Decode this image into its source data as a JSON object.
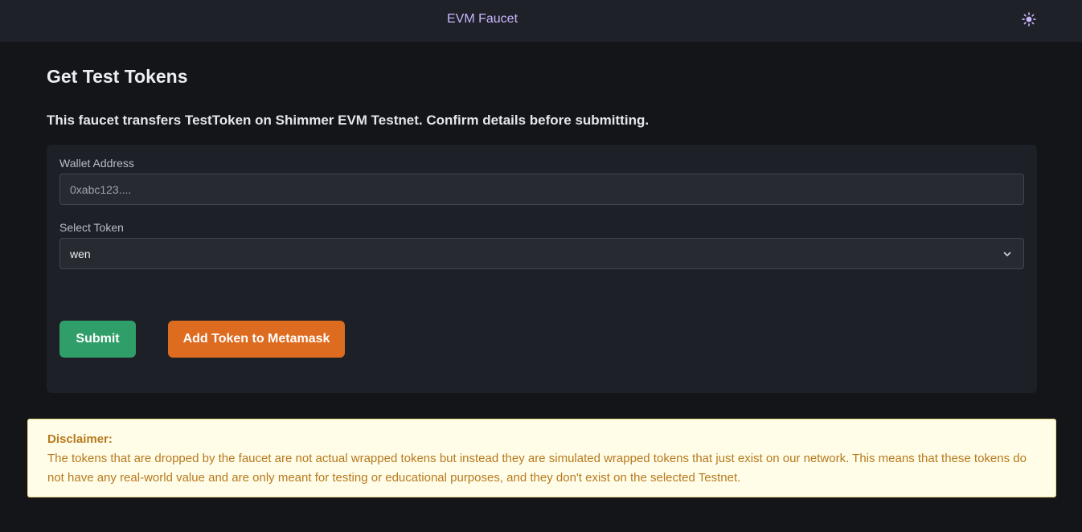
{
  "header": {
    "title": "EVM Faucet",
    "theme_icon": "sun-icon"
  },
  "main": {
    "heading": "Get Test Tokens",
    "subheading": "This faucet transfers TestToken on Shimmer EVM Testnet. Confirm details before submitting.",
    "wallet": {
      "label": "Wallet Address",
      "placeholder": "0xabc123....",
      "value": ""
    },
    "token": {
      "label": "Select Token",
      "selected": "wen",
      "icon": "chevron-down-icon"
    },
    "buttons": {
      "submit": "Submit",
      "add_token": "Add Token to Metamask"
    }
  },
  "disclaimer": {
    "title": "Disclaimer:",
    "body": "The tokens that are dropped by the faucet are not actual wrapped tokens but instead they are simulated wrapped tokens that just exist on our network. This means that these tokens do not have any real-world value and are only meant for testing or educational purposes, and they don't exist on the selected Testnet."
  },
  "colors": {
    "background": "#141519",
    "header": "#1f2128",
    "card": "#1e2027",
    "accent_title": "#c8b6ff",
    "submit_green": "#2f9e69",
    "metamask_orange": "#dd6b20",
    "disclaimer_bg": "#fffde7",
    "disclaimer_text": "#b7791f"
  }
}
